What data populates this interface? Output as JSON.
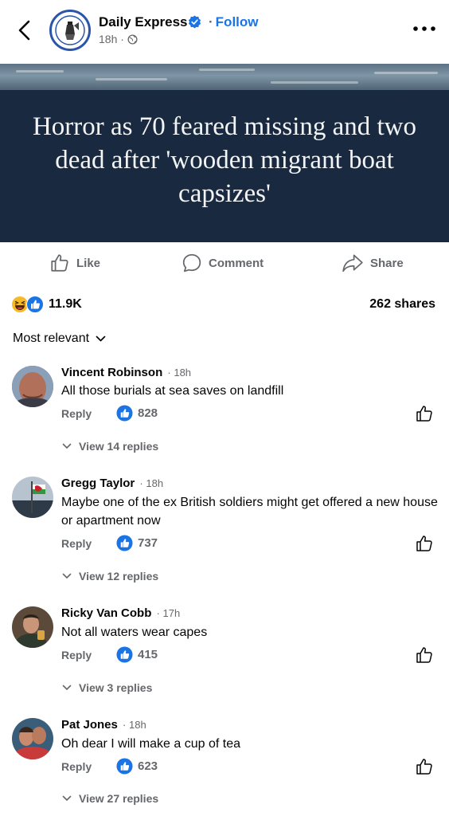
{
  "header": {
    "page_name": "Daily Express",
    "follow_label": "Follow",
    "separator": "·",
    "time": "18h ·",
    "icons": [
      "back-arrow-icon",
      "daily-express-logo",
      "verified-badge-icon",
      "globe-icon",
      "more-options-icon"
    ]
  },
  "post": {
    "headline": "Horror as 70 feared missing and two dead after 'wooden migrant boat capsizes'"
  },
  "actions": {
    "like": "Like",
    "comment": "Comment",
    "share": "Share"
  },
  "stats": {
    "reactions": "11.9K",
    "shares": "262 shares"
  },
  "sort": {
    "label": "Most relevant"
  },
  "colors": {
    "accent": "#1b74e4",
    "secondary_text": "#65676b",
    "hero_bg": "#192a40"
  },
  "comments": [
    {
      "name": "Vincent Robinson",
      "time": "· 18h",
      "text": "All those burials at sea saves on landfill",
      "reply_label": "Reply",
      "likes": "828",
      "view_replies": "View 14 replies"
    },
    {
      "name": "Gregg Taylor",
      "time": "· 18h",
      "text": "Maybe one of the ex British soldiers might get offered a new house or apartment now",
      "reply_label": "Reply",
      "likes": "737",
      "view_replies": "View 12 replies"
    },
    {
      "name": "Ricky Van Cobb",
      "time": "· 17h",
      "text": "Not all waters wear capes",
      "reply_label": "Reply",
      "likes": "415",
      "view_replies": "View 3 replies"
    },
    {
      "name": "Pat Jones",
      "time": "· 18h",
      "text": "Oh dear I will make a cup of tea",
      "reply_label": "Reply",
      "likes": "623",
      "view_replies": "View 27 replies"
    }
  ]
}
